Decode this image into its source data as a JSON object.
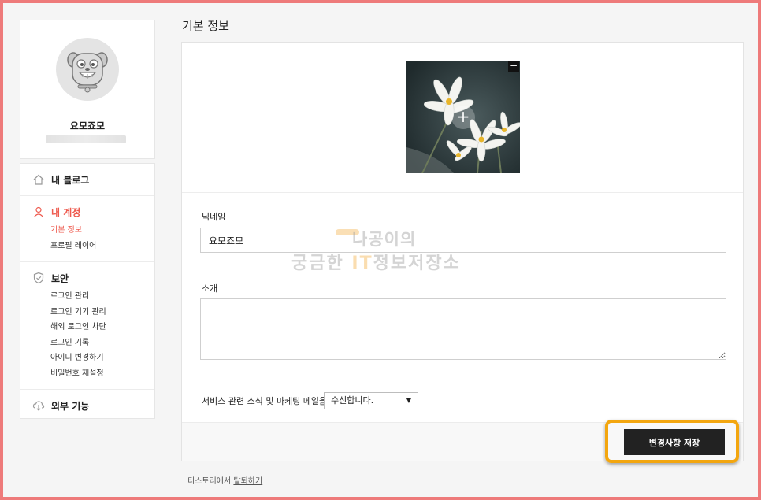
{
  "page": {
    "title": "기본 정보"
  },
  "profile": {
    "nickname": "요모죠모"
  },
  "sidebar": {
    "sections": [
      {
        "label": "내 블로그",
        "icon": "home-icon",
        "items": []
      },
      {
        "label": "내 계정",
        "icon": "user-icon",
        "active": true,
        "items": [
          "기본 정보",
          "프로필 레이어"
        ]
      },
      {
        "label": "보안",
        "icon": "shield-icon",
        "items": [
          "로그인 관리",
          "로그인 기기 관리",
          "해외 로그인 차단",
          "로그인 기록",
          "아이디 변경하기",
          "비밀번호 재설정"
        ]
      },
      {
        "label": "외부 기능",
        "icon": "cloud-download-icon",
        "items": []
      }
    ]
  },
  "form": {
    "nickname_label": "닉네임",
    "nickname_value": "요모죠모",
    "intro_label": "소개",
    "intro_value": "",
    "marketing_label": "서비스 관련 소식 및 마케팅 메일을",
    "marketing_select": "수신합니다.",
    "photo_remove_symbol": "−",
    "photo_add_symbol": "+"
  },
  "actions": {
    "save_label": "변경사항 저장"
  },
  "footer": {
    "withdraw_prefix": "티스토리에서 ",
    "withdraw_link": "탈퇴하기"
  },
  "watermark": {
    "line1": "나공이의",
    "line2_pre": "궁금한 ",
    "line2_it": "IT",
    "line2_post": "정보저장소"
  },
  "colors": {
    "accent": "#ee5b4f",
    "highlight": "#f3a60f",
    "frame": "#ee7a7a",
    "button": "#222222"
  }
}
